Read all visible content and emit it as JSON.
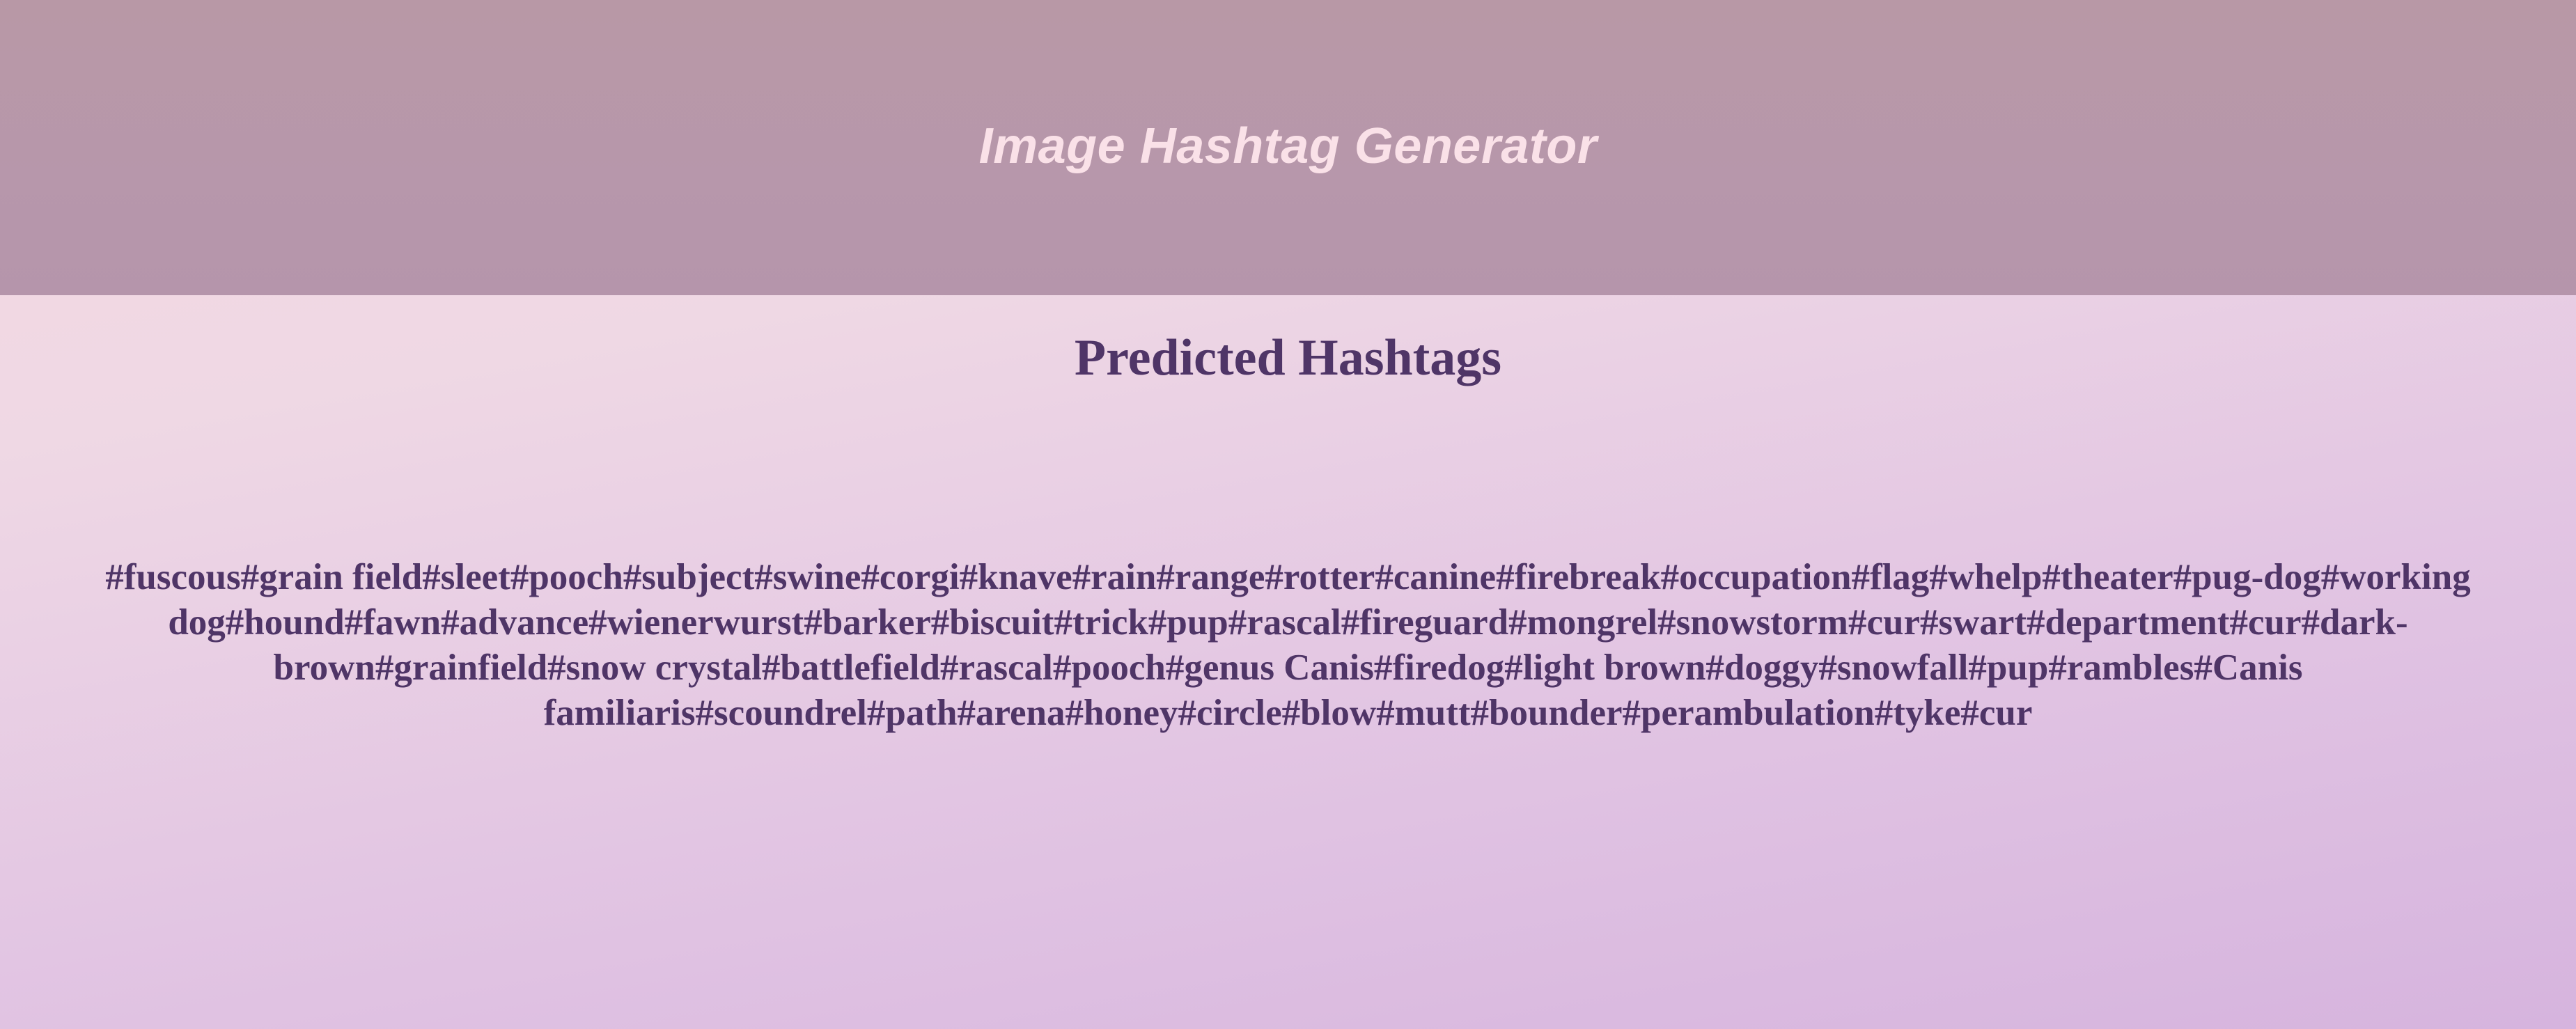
{
  "header": {
    "title": "Image Hashtag Generator"
  },
  "results": {
    "heading": "Predicted Hashtags",
    "hashtags": [
      "#fuscous",
      "#grain field",
      "#sleet",
      "#pooch",
      "#subject",
      "#swine",
      "#corgi",
      "#knave",
      "#rain",
      "#range",
      "#rotter",
      "#canine",
      "#firebreak",
      "#occupation",
      "#flag",
      "#whelp",
      "#theater",
      "#pug-dog",
      "#working dog",
      "#hound",
      "#fawn",
      "#advance",
      "#wienerwurst",
      "#barker",
      "#biscuit",
      "#trick",
      "#pup",
      "#rascal",
      "#fireguard",
      "#mongrel",
      "#snowstorm",
      "#cur",
      "#swart",
      "#department",
      "#cur",
      "#dark-brown",
      "#grainfield",
      "#snow crystal",
      "#battlefield",
      "#rascal",
      "#pooch",
      "#genus Canis",
      "#firedog",
      "#light brown",
      "#doggy",
      "#snowfall",
      "#pup",
      "#rambles",
      "#Canis familiaris",
      "#scoundrel",
      "#path",
      "#arena",
      "#honey",
      "#circle",
      "#blow",
      "#mutt",
      "#bounder",
      "#perambulation",
      "#tyke",
      "#cur"
    ]
  },
  "colors": {
    "header_bg": "#b797ab",
    "title_text": "#fae1e8",
    "body_text": "#4f3567"
  }
}
